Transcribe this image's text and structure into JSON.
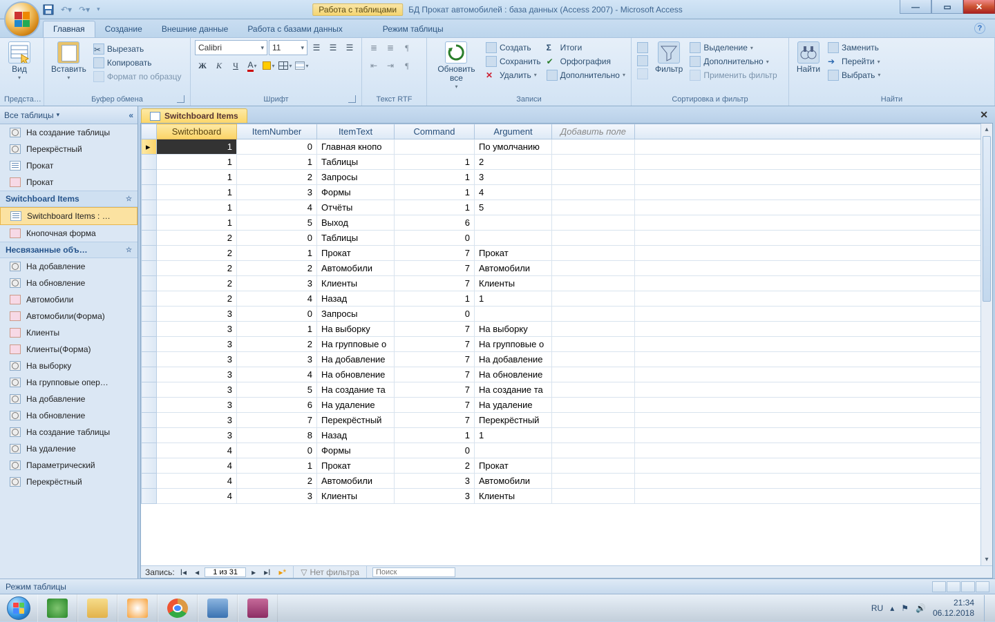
{
  "title": {
    "tool_context": "Работа с таблицами",
    "app_title": "БД Прокат автомобилей : база данных (Access 2007) - Microsoft Access"
  },
  "ribbon": {
    "tabs": [
      "Главная",
      "Создание",
      "Внешние данные",
      "Работа с базами данных",
      "Режим таблицы"
    ],
    "active_tab": 0,
    "groups": {
      "views": {
        "label": "Предста…",
        "btn": "Вид"
      },
      "clipboard": {
        "label": "Буфер обмена",
        "paste": "Вставить",
        "cut": "Вырезать",
        "copy": "Копировать",
        "painter": "Формат по образцу"
      },
      "font": {
        "label": "Шрифт",
        "name": "Calibri",
        "size": "11"
      },
      "richtext": {
        "label": "Текст RTF"
      },
      "records": {
        "label": "Записи",
        "refresh": "Обновить все",
        "new": "Создать",
        "save": "Сохранить",
        "delete": "Удалить",
        "totals": "Итоги",
        "spelling": "Орфография",
        "more": "Дополнительно"
      },
      "sortfilter": {
        "label": "Сортировка и фильтр",
        "filter": "Фильтр",
        "selection": "Выделение",
        "advanced": "Дополнительно",
        "toggle": "Применить фильтр"
      },
      "find": {
        "label": "Найти",
        "find": "Найти",
        "replace": "Заменить",
        "goto": "Перейти",
        "select": "Выбрать"
      }
    }
  },
  "nav": {
    "header": "Все таблицы",
    "items": [
      {
        "type": "item",
        "icon": "query",
        "label": "На создание таблицы"
      },
      {
        "type": "item",
        "icon": "query",
        "label": "Перекрёстный"
      },
      {
        "type": "item",
        "icon": "table",
        "label": "Прокат"
      },
      {
        "type": "item",
        "icon": "form",
        "label": "Прокат"
      },
      {
        "type": "group",
        "label": "Switchboard Items"
      },
      {
        "type": "item",
        "icon": "table",
        "label": "Switchboard Items : …",
        "selected": true
      },
      {
        "type": "item",
        "icon": "form",
        "label": "Кнопочная форма"
      },
      {
        "type": "group",
        "label": "Несвязанные объ…"
      },
      {
        "type": "item",
        "icon": "query",
        "label": "На добавление"
      },
      {
        "type": "item",
        "icon": "query",
        "label": "На обновление"
      },
      {
        "type": "item",
        "icon": "form",
        "label": "Автомобили"
      },
      {
        "type": "item",
        "icon": "form",
        "label": "Автомобили(Форма)"
      },
      {
        "type": "item",
        "icon": "form",
        "label": "Клиенты"
      },
      {
        "type": "item",
        "icon": "form",
        "label": "Клиенты(Форма)"
      },
      {
        "type": "item",
        "icon": "query",
        "label": "На выборку"
      },
      {
        "type": "item",
        "icon": "query",
        "label": "На групповые опер…"
      },
      {
        "type": "item",
        "icon": "query",
        "label": "На добавление"
      },
      {
        "type": "item",
        "icon": "query",
        "label": "На обновление"
      },
      {
        "type": "item",
        "icon": "query",
        "label": "На создание таблицы"
      },
      {
        "type": "item",
        "icon": "query",
        "label": "На удаление"
      },
      {
        "type": "item",
        "icon": "query",
        "label": "Параметрический"
      },
      {
        "type": "item",
        "icon": "query",
        "label": "Перекрёстный"
      }
    ]
  },
  "document": {
    "tab_label": "Switchboard Items",
    "columns": [
      "Switchboard",
      "ItemNumber",
      "ItemText",
      "Command",
      "Argument"
    ],
    "add_field": "Добавить поле",
    "rows": [
      [
        "1",
        "0",
        "Главная кнопо",
        "",
        "По умолчанию"
      ],
      [
        "1",
        "1",
        "Таблицы",
        "1",
        "2"
      ],
      [
        "1",
        "2",
        "Запросы",
        "1",
        "3"
      ],
      [
        "1",
        "3",
        "Формы",
        "1",
        "4"
      ],
      [
        "1",
        "4",
        "Отчёты",
        "1",
        "5"
      ],
      [
        "1",
        "5",
        "Выход",
        "6",
        ""
      ],
      [
        "2",
        "0",
        "Таблицы",
        "0",
        ""
      ],
      [
        "2",
        "1",
        "Прокат",
        "7",
        "Прокат"
      ],
      [
        "2",
        "2",
        "Автомобили",
        "7",
        "Автомобили"
      ],
      [
        "2",
        "3",
        "Клиенты",
        "7",
        "Клиенты"
      ],
      [
        "2",
        "4",
        "Назад",
        "1",
        "1"
      ],
      [
        "3",
        "0",
        "Запросы",
        "0",
        ""
      ],
      [
        "3",
        "1",
        "На выборку",
        "7",
        "На выборку"
      ],
      [
        "3",
        "2",
        "На групповые о",
        "7",
        "На групповые о"
      ],
      [
        "3",
        "3",
        "На добавление",
        "7",
        "На добавление"
      ],
      [
        "3",
        "4",
        "На обновление",
        "7",
        "На обновление"
      ],
      [
        "3",
        "5",
        "На создание та",
        "7",
        "На создание та"
      ],
      [
        "3",
        "6",
        "На удаление",
        "7",
        "На удаление"
      ],
      [
        "3",
        "7",
        "Перекрёстный",
        "7",
        "Перекрёстный"
      ],
      [
        "3",
        "8",
        "Назад",
        "1",
        "1"
      ],
      [
        "4",
        "0",
        "Формы",
        "0",
        ""
      ],
      [
        "4",
        "1",
        "Прокат",
        "2",
        "Прокат"
      ],
      [
        "4",
        "2",
        "Автомобили",
        "3",
        "Автомобили"
      ],
      [
        "4",
        "3",
        "Клиенты",
        "3",
        "Клиенты"
      ]
    ],
    "record_nav": {
      "label": "Запись:",
      "position": "1 из 31",
      "no_filter": "Нет фильтра",
      "search": "Поиск"
    }
  },
  "statusbar": {
    "mode": "Режим таблицы"
  },
  "taskbar": {
    "lang": "RU",
    "time": "21:34",
    "date": "06.12.2018"
  }
}
